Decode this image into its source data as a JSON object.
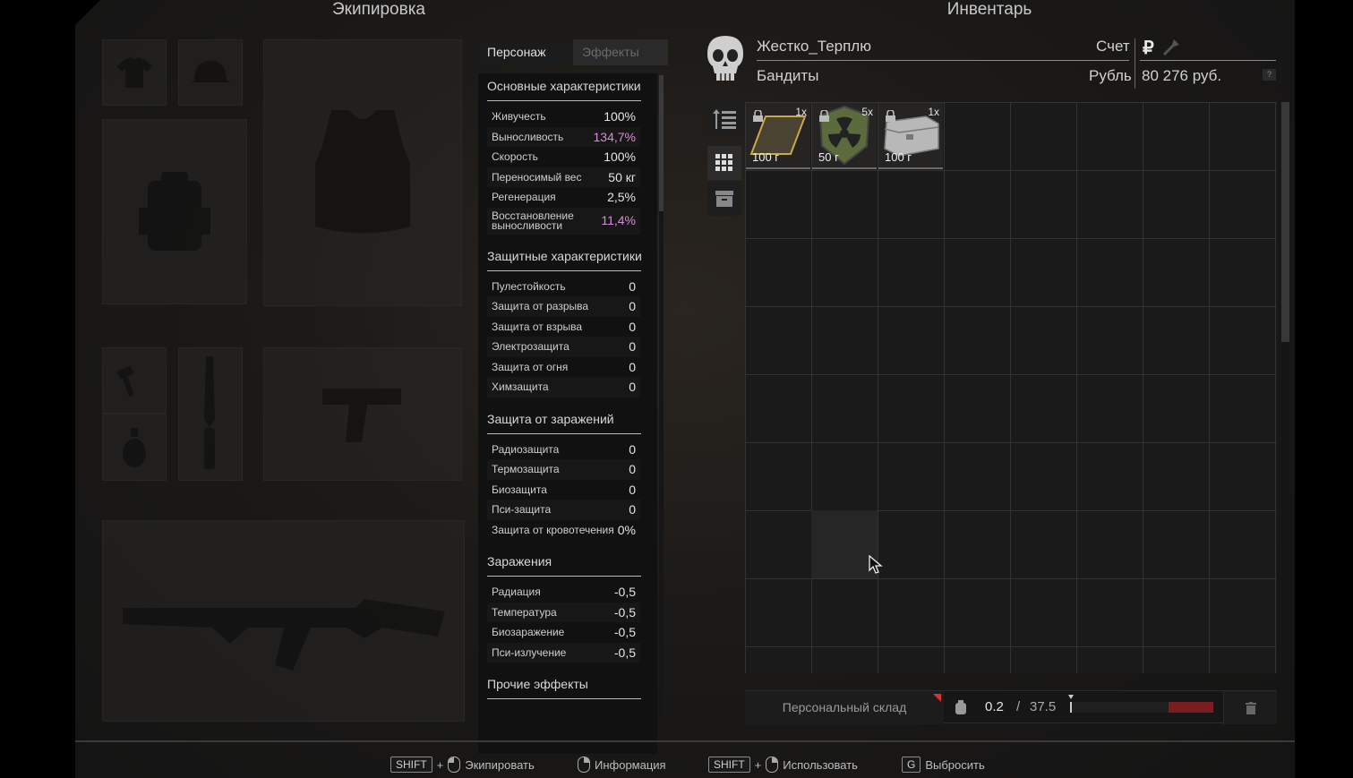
{
  "equipment": {
    "title": "Экипировка"
  },
  "inventory": {
    "title": "Инвентарь",
    "player_name": "Жестко_Терплю",
    "faction": "Бандиты",
    "account_label": "Счет",
    "currency_label": "Рубль",
    "balance": "80 276 руб.",
    "currency_symbol": "₽",
    "help": "?",
    "items": [
      {
        "count": "1x",
        "weight": "100 г",
        "icon": "gold-plate-icon",
        "locked": true
      },
      {
        "count": "5x",
        "weight": "50 г",
        "icon": "radiation-patch-icon",
        "locked": true
      },
      {
        "count": "1x",
        "weight": "100 г",
        "icon": "metal-case-icon",
        "locked": true
      }
    ]
  },
  "stats": {
    "tabs": [
      "Персонаж",
      "Эффекты"
    ],
    "groups": [
      {
        "title": "Основные характеристики",
        "rows": [
          {
            "label": "Живучесть",
            "value": "100%"
          },
          {
            "label": "Выносливость",
            "value": "134,7%"
          },
          {
            "label": "Скорость",
            "value": "100%"
          },
          {
            "label": "Переносимый вес",
            "value": "50 кг"
          },
          {
            "label": "Регенерация",
            "value": "2,5%"
          },
          {
            "label": "Восстановление выносливости",
            "value": "11,4%"
          }
        ]
      },
      {
        "title": "Защитные характеристики",
        "rows": [
          {
            "label": "Пулестойкость",
            "value": "0"
          },
          {
            "label": "Защита от разрыва",
            "value": "0"
          },
          {
            "label": "Защита от взрыва",
            "value": "0"
          },
          {
            "label": "Электрозащита",
            "value": "0"
          },
          {
            "label": "Защита от огня",
            "value": "0"
          },
          {
            "label": "Химзащита",
            "value": "0"
          }
        ]
      },
      {
        "title": "Защита от заражений",
        "rows": [
          {
            "label": "Радиозащита",
            "value": "0"
          },
          {
            "label": "Термозащита",
            "value": "0"
          },
          {
            "label": "Биозащита",
            "value": "0"
          },
          {
            "label": "Пси-защита",
            "value": "0"
          },
          {
            "label": "Защита от кровотечения",
            "value": "0%"
          }
        ]
      },
      {
        "title": "Заражения",
        "rows": [
          {
            "label": "Радиация",
            "value": "-0,5"
          },
          {
            "label": "Температура",
            "value": "-0,5"
          },
          {
            "label": "Биозаражение",
            "value": "-0,5"
          },
          {
            "label": "Пси-излучение",
            "value": "-0,5"
          }
        ]
      },
      {
        "title": "Прочие эффекты",
        "rows": []
      }
    ]
  },
  "storage": {
    "label": "Персональный склад",
    "weight_current": "0.2",
    "weight_sep": "/",
    "weight_max": "37.5",
    "weight_fill_fraction": 0.005
  },
  "footer": {
    "hints": [
      {
        "key": "SHIFT",
        "plus": "+",
        "action": "Экипировать"
      },
      {
        "action": "Информация"
      },
      {
        "key": "SHIFT",
        "plus": "+",
        "action": "Использовать"
      },
      {
        "key": "G",
        "action": "Выбросить"
      }
    ]
  },
  "colors": {
    "accent_pink": "#d98ad8",
    "overweight_red": "#7a1d20",
    "marker_red": "#e0302f"
  }
}
